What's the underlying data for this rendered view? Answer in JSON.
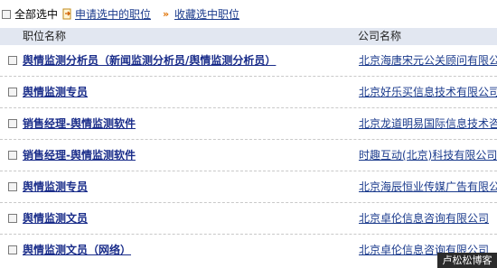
{
  "toolbar": {
    "select_all_label": "全部选中",
    "apply_label": "申请选中的职位",
    "collect_label": "收藏选中职位",
    "collect_icon_glyph": "»",
    "apply_icon": "apply-document-icon",
    "collect_icon": "double-chevron-right-icon",
    "accent_color": "#e07000"
  },
  "header": {
    "title_col": "职位名称",
    "company_col": "公司名称",
    "background_color": "#e2e7f1"
  },
  "rows": [
    {
      "title": "舆情监测分析员（新闻监测分析员/舆情监测分析员）",
      "company": "北京海唐宋元公关顾问有限公司"
    },
    {
      "title": "舆情监测专员",
      "company": "北京好乐买信息技术有限公司"
    },
    {
      "title": "销售经理-舆情监测软件",
      "company": "北京龙道明易国际信息技术咨询有限公司"
    },
    {
      "title": "销售经理-舆情监测软件",
      "company": "时趣互动(北京)科技有限公司"
    },
    {
      "title": "舆情监测专员",
      "company": "北京海辰恒业传媒广告有限公司"
    },
    {
      "title": "舆情监测文员",
      "company": "北京卓伦信息咨询有限公司"
    },
    {
      "title": "舆情监测文员（网络）",
      "company": "北京卓伦信息咨询有限公司"
    }
  ],
  "watermark": {
    "text": "卢松松博客"
  },
  "colors": {
    "link": "#1a3a8c",
    "title_link": "#1a2d8a"
  }
}
